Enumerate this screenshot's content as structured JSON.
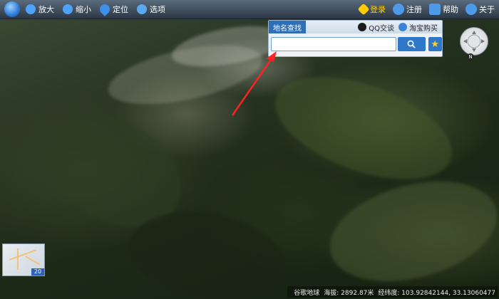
{
  "toolbar": {
    "zoom_in": "放大",
    "zoom_out": "缩小",
    "locate": "定位",
    "options": "选项",
    "login": "登录",
    "register": "注册",
    "help": "帮助",
    "about": "关于"
  },
  "search_panel": {
    "tab_label": "地名查找",
    "qq_link": "QQ交谈",
    "taobao_link": "淘宝购买",
    "input_value": "",
    "search_icon": "search-icon",
    "favorite_icon": "star-icon"
  },
  "compass": {
    "north_label": "N"
  },
  "minimap": {
    "zoom_level": "20"
  },
  "status_bar": {
    "source": "谷歌地球",
    "altitude": "海拔: 2892.87米",
    "coords": "经纬度: 103.92842144, 33.13060477"
  },
  "colors": {
    "toolbar": "#3a4756",
    "accent": "#2f77c9",
    "login": "#ffd000",
    "annotation_arrow": "#ff2222"
  }
}
